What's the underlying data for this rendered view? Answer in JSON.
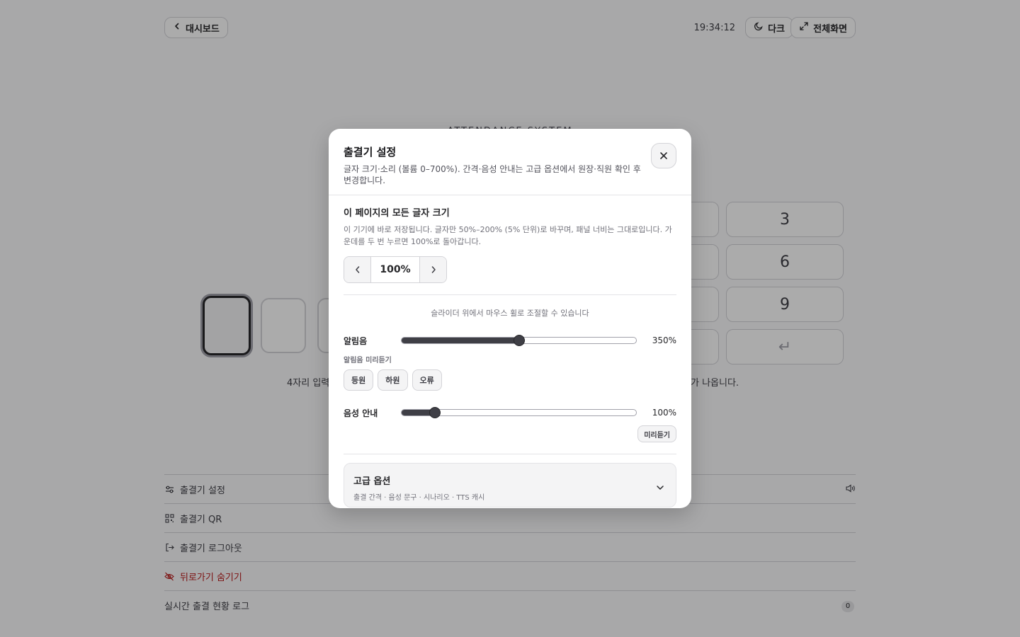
{
  "topbar": {
    "back_label": "대시보드",
    "clock": "19:34:12",
    "dark_label": "다크",
    "fullscreen_label": "전체화면"
  },
  "system_title": "ATTENDANCE SYSTEM",
  "keypad": {
    "keys": [
      "3",
      "6",
      "9",
      "↵"
    ]
  },
  "hints": {
    "left": "4자리 입력",
    "right": "가 나옵니다."
  },
  "menu": {
    "settings": "출결기 설정",
    "qr": "출결기 QR",
    "logout": "출결기 로그아웃",
    "hide_back": "뒤로가기 숨기기",
    "live_log": "실시간 출결 현황 로그",
    "live_log_count": "0"
  },
  "modal": {
    "title": "출결기 설정",
    "description": "글자 크기·소리 (볼륨 0–700%). 간격·음성 안내는 고급 옵션에서 원장·직원 확인 후 변경합니다.",
    "font_section": {
      "title": "이 페이지의 모든 글자 크기",
      "description": "이 기기에 바로 저장됩니다. 글자만 50%–200% (5% 단위)로 바꾸며, 패널 너비는 그대로입니다. 가운데를 두 번 누르면 100%로 돌아갑니다.",
      "value": "100%"
    },
    "wheel_hint": "슬라이더 위에서 마우스 휠로 조절할 수 있습니다",
    "alarm": {
      "label": "알림음",
      "value": "350%",
      "level": 0.5,
      "preview_label": "알림음 미리듣기",
      "preview_buttons": [
        "등원",
        "하원",
        "오류"
      ]
    },
    "voice": {
      "label": "음성 안내",
      "value": "100%",
      "level": 0.1429,
      "preview_button": "미리듣기"
    },
    "advanced": {
      "title": "고급 옵션",
      "subtitle": "출결 간격 · 음성 문구 · 시나리오 · TTS 캐시"
    }
  }
}
